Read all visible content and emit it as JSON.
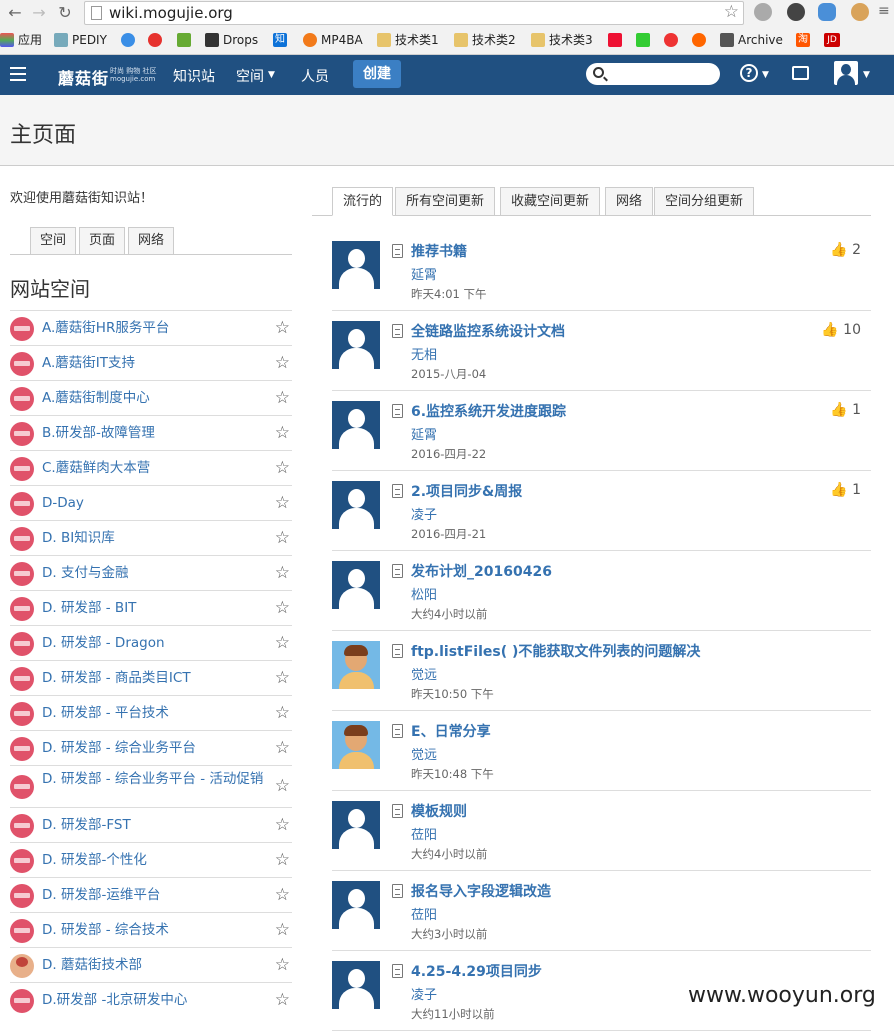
{
  "browser": {
    "url": "wiki.mogujie.org",
    "bookmarks": [
      "应用",
      "PEDIY",
      "",
      "",
      "",
      "Drops",
      "知",
      "MP4BA",
      "技术类1",
      "技术类2",
      "技术类3",
      "",
      "",
      "",
      "",
      "Archive",
      "淘",
      "JD"
    ]
  },
  "header": {
    "logo": "蘑菇街",
    "logo_sub": "时尚 购物 社区\nmogujie.com",
    "nav": [
      "知识站",
      "空间",
      "人员"
    ],
    "create": "创建"
  },
  "page": {
    "title": "主页面",
    "welcome": "欢迎使用蘑菇街知识站！",
    "left_tabs": [
      "空间",
      "页面",
      "网络"
    ],
    "section_title": "网站空间",
    "spaces": [
      "A.蘑菇街HR服务平台",
      "A.蘑菇街IT支持",
      "A.蘑菇街制度中心",
      "B.研发部-故障管理",
      "C.蘑菇鲜肉大本营",
      "D-Day",
      "D. BI知识库",
      "D. 支付与金融",
      "D. 研发部 - BIT",
      "D. 研发部 - Dragon",
      "D. 研发部 - 商品类目ICT",
      "D. 研发部 - 平台技术",
      "D. 研发部 - 综合业务平台",
      "D. 研发部 - 综合业务平台 - 活动促销",
      "D. 研发部-FST",
      "D. 研发部-个性化",
      "D. 研发部-运维平台",
      "D. 研发部 - 综合技术",
      "D. 蘑菇街技术部",
      "D.研发部 -北京研发中心"
    ],
    "right_tabs": [
      "流行的",
      "所有空间更新",
      "收藏空间更新",
      "网络",
      "空间分组更新"
    ],
    "feed": [
      {
        "title": "推荐书籍",
        "author": "延霄",
        "date": "昨天4:01 下午",
        "likes": "2",
        "photo": false
      },
      {
        "title": "全链路监控系统设计文档",
        "author": "无相",
        "date": "2015-八月-04",
        "likes": "10",
        "photo": false
      },
      {
        "title": "6.监控系统开发进度跟踪",
        "author": "延霄",
        "date": "2016-四月-22",
        "likes": "1",
        "photo": false
      },
      {
        "title": "2.项目同步&周报",
        "author": "凌子",
        "date": "2016-四月-21",
        "likes": "1",
        "photo": false
      },
      {
        "title": "发布计划_20160426",
        "author": "松阳",
        "date": "大约4小时以前",
        "likes": "",
        "photo": false
      },
      {
        "title": "ftp.listFiles( )不能获取文件列表的问题解决",
        "author": "觉远",
        "date": "昨天10:50 下午",
        "likes": "",
        "photo": true
      },
      {
        "title": "E、日常分享",
        "author": "觉远",
        "date": "昨天10:48 下午",
        "likes": "",
        "photo": true
      },
      {
        "title": "模板规则",
        "author": "莅阳",
        "date": "大约4小时以前",
        "likes": "",
        "photo": false
      },
      {
        "title": "报名导入字段逻辑改造",
        "author": "莅阳",
        "date": "大约3小时以前",
        "likes": "",
        "photo": false
      },
      {
        "title": "4.25-4.29项目同步",
        "author": "凌子",
        "date": "大约11小时以前",
        "likes": "",
        "photo": false
      }
    ]
  },
  "watermark": "www.wooyun.org"
}
